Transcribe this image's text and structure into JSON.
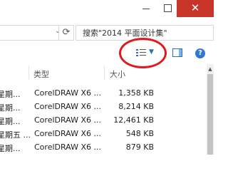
{
  "window": {
    "minimize_glyph": "—",
    "close_glyph": "✕"
  },
  "search": {
    "placeholder": "搜索\"2014 平面设计集\""
  },
  "toolbar": {
    "view_icon": "details-view-icon",
    "dropdown_glyph": "▼",
    "help_glyph": "?"
  },
  "columns": {
    "type": "类型",
    "size": "大小"
  },
  "files": [
    {
      "date": "星期...",
      "type": "CorelDRAW X6 ...",
      "size": "1,358 KB"
    },
    {
      "date": "星期...",
      "type": "CorelDRAW X6 ...",
      "size": "8,214 KB"
    },
    {
      "date": "星期...",
      "type": "CorelDRAW X6 ...",
      "size": "12,461 KB"
    },
    {
      "date": "星期五 ...",
      "type": "CorelDRAW X6 ...",
      "size": "548 KB"
    },
    {
      "date": "星期...",
      "type": "CorelDRAW X6 ...",
      "size": "879 KB"
    }
  ],
  "colors": {
    "close_button": "#c7352a",
    "highlight_ring": "#e0191f",
    "accent_blue": "#2f78d3"
  }
}
